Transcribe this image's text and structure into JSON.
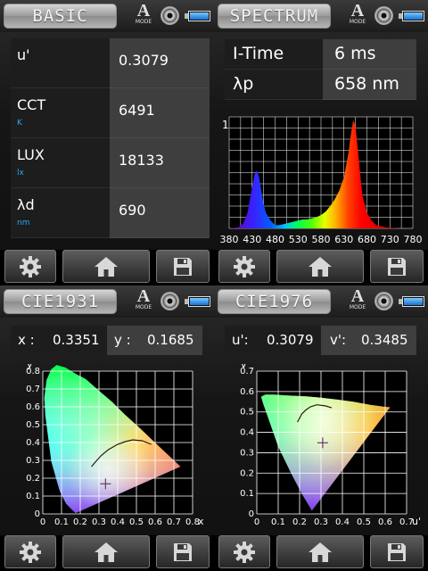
{
  "basic": {
    "title": "BASIC",
    "mode_letter": "A",
    "mode_label": "MODE",
    "rows": [
      {
        "label": "u'",
        "unit": "",
        "value": "0.3079"
      },
      {
        "label": "CCT",
        "unit": "K",
        "value": "6491"
      },
      {
        "label": "LUX",
        "unit": "lx",
        "value": "18133"
      },
      {
        "label": "λd",
        "unit": "nm",
        "value": "690"
      }
    ]
  },
  "spectrum": {
    "title": "SPECTRUM",
    "mode_letter": "A",
    "mode_label": "MODE",
    "rows": [
      {
        "label": "I-Time",
        "value": "6 ms"
      },
      {
        "label": "λp",
        "value": "658 nm"
      }
    ],
    "chart_data": {
      "type": "area",
      "title": "",
      "xlabel": "",
      "ylabel": "",
      "xlim": [
        380,
        780
      ],
      "ylim": [
        0,
        1
      ],
      "y_tick_label": "1",
      "x_ticks": [
        380,
        430,
        480,
        530,
        580,
        630,
        680,
        730,
        780
      ],
      "grid": true,
      "x": [
        380,
        400,
        410,
        420,
        430,
        435,
        440,
        445,
        450,
        455,
        460,
        470,
        480,
        490,
        500,
        510,
        520,
        530,
        540,
        550,
        560,
        570,
        580,
        590,
        600,
        610,
        620,
        630,
        640,
        645,
        650,
        655,
        660,
        665,
        670,
        680,
        690,
        700,
        720,
        750,
        780
      ],
      "y": [
        0,
        0.01,
        0.04,
        0.14,
        0.37,
        0.48,
        0.52,
        0.46,
        0.34,
        0.22,
        0.14,
        0.07,
        0.03,
        0.03,
        0.04,
        0.05,
        0.06,
        0.07,
        0.08,
        0.08,
        0.09,
        0.1,
        0.12,
        0.15,
        0.2,
        0.26,
        0.34,
        0.46,
        0.68,
        0.84,
        0.97,
        0.92,
        0.72,
        0.5,
        0.3,
        0.14,
        0.07,
        0.03,
        0.01,
        0.0,
        0
      ]
    }
  },
  "cie1931": {
    "title": "CIE1931",
    "mode_letter": "A",
    "mode_label": "MODE",
    "x_label": "x  :",
    "x_value": "0.3351",
    "y_label": "y  :",
    "y_value": "0.1685",
    "chart_data": {
      "type": "scatter",
      "xlabel": "x",
      "ylabel": "y",
      "xlim": [
        0,
        0.8
      ],
      "ylim": [
        0,
        0.8
      ],
      "x_ticks": [
        "0",
        "0.1",
        "0.2",
        "0.3",
        "0.4",
        "0.5",
        "0.6",
        "0.7",
        "0.8"
      ],
      "y_ticks": [
        "0",
        "0.1",
        "0.2",
        "0.3",
        "0.4",
        "0.5",
        "0.6",
        "0.7",
        "0.8"
      ],
      "grid": true,
      "point": {
        "x": 0.3351,
        "y": 0.1685
      }
    }
  },
  "cie1976": {
    "title": "CIE1976",
    "mode_letter": "A",
    "mode_label": "MODE",
    "u_label": "u':",
    "u_value": "0.3079",
    "v_label": "v':",
    "v_value": "0.3485",
    "chart_data": {
      "type": "scatter",
      "xlabel": "u'",
      "ylabel": "v'",
      "xlim": [
        0,
        0.7
      ],
      "ylim": [
        0,
        0.7
      ],
      "x_ticks": [
        "0",
        "0.1",
        "0.2",
        "0.3",
        "0.4",
        "0.5",
        "0.6",
        "0.7"
      ],
      "y_ticks": [
        "0",
        "0.1",
        "0.2",
        "0.3",
        "0.4",
        "0.5",
        "0.6",
        "0.7"
      ],
      "grid": true,
      "point": {
        "x": 0.3079,
        "y": 0.3485
      }
    }
  },
  "footer": {
    "buttons": [
      "settings-gear-icon",
      "home-icon",
      "save-floppy-icon"
    ]
  }
}
